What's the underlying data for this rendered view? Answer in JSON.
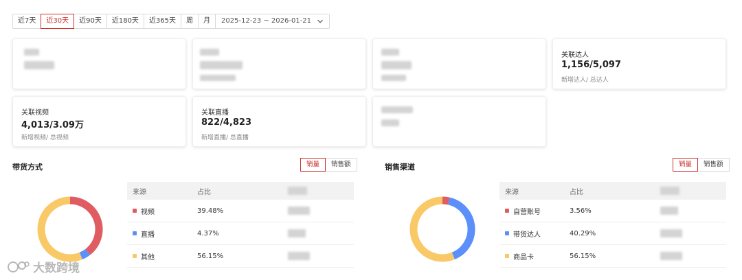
{
  "filters": {
    "ranges": [
      "近7天",
      "近30天",
      "近90天",
      "近180天",
      "近365天",
      "周",
      "月"
    ],
    "active_range": "近30天",
    "date_range": "2025-12-23 ~ 2026-01-21"
  },
  "cards": {
    "linked_creators": {
      "label": "关联达人",
      "value": "1,156/5,097",
      "sub": "新增达人/ 总达人"
    },
    "linked_videos": {
      "label": "关联视频",
      "value": "4,013/3.09万",
      "sub": "新增视频/ 总视频"
    },
    "linked_live": {
      "label": "关联直播",
      "value": "822/4,823",
      "sub": "新增直播/ 总直播"
    }
  },
  "sections": {
    "method": {
      "title": "带货方式",
      "toggle": {
        "volume": "销量",
        "amount": "销售额",
        "active": "销量"
      },
      "headers": {
        "source": "来源",
        "share": "占比"
      },
      "rows": [
        {
          "name": "视频",
          "share": "39.48%",
          "color": "#e05c63"
        },
        {
          "name": "直播",
          "share": "4.37%",
          "color": "#5b8ff9"
        },
        {
          "name": "其他",
          "share": "56.15%",
          "color": "#f9c867"
        }
      ]
    },
    "channel": {
      "title": "销售渠道",
      "toggle": {
        "volume": "销量",
        "amount": "销售额",
        "active": "销量"
      },
      "headers": {
        "source": "来源",
        "share": "占比"
      },
      "rows": [
        {
          "name": "自营账号",
          "share": "3.56%",
          "color": "#e05c63"
        },
        {
          "name": "带货达人",
          "share": "40.29%",
          "color": "#5b8ff9"
        },
        {
          "name": "商品卡",
          "share": "56.15%",
          "color": "#f9c867"
        }
      ]
    }
  },
  "chart_data": [
    {
      "type": "pie",
      "categories": [
        "视频",
        "直播",
        "其他"
      ],
      "values": [
        39.48,
        4.37,
        56.15
      ],
      "colors": [
        "#e05c63",
        "#5b8ff9",
        "#f9c867"
      ]
    },
    {
      "type": "pie",
      "categories": [
        "自营账号",
        "带货达人",
        "商品卡"
      ],
      "values": [
        3.56,
        40.29,
        56.15
      ],
      "colors": [
        "#e05c63",
        "#5b8ff9",
        "#f9c867"
      ]
    }
  ],
  "watermark": {
    "text": "大数跨境"
  }
}
